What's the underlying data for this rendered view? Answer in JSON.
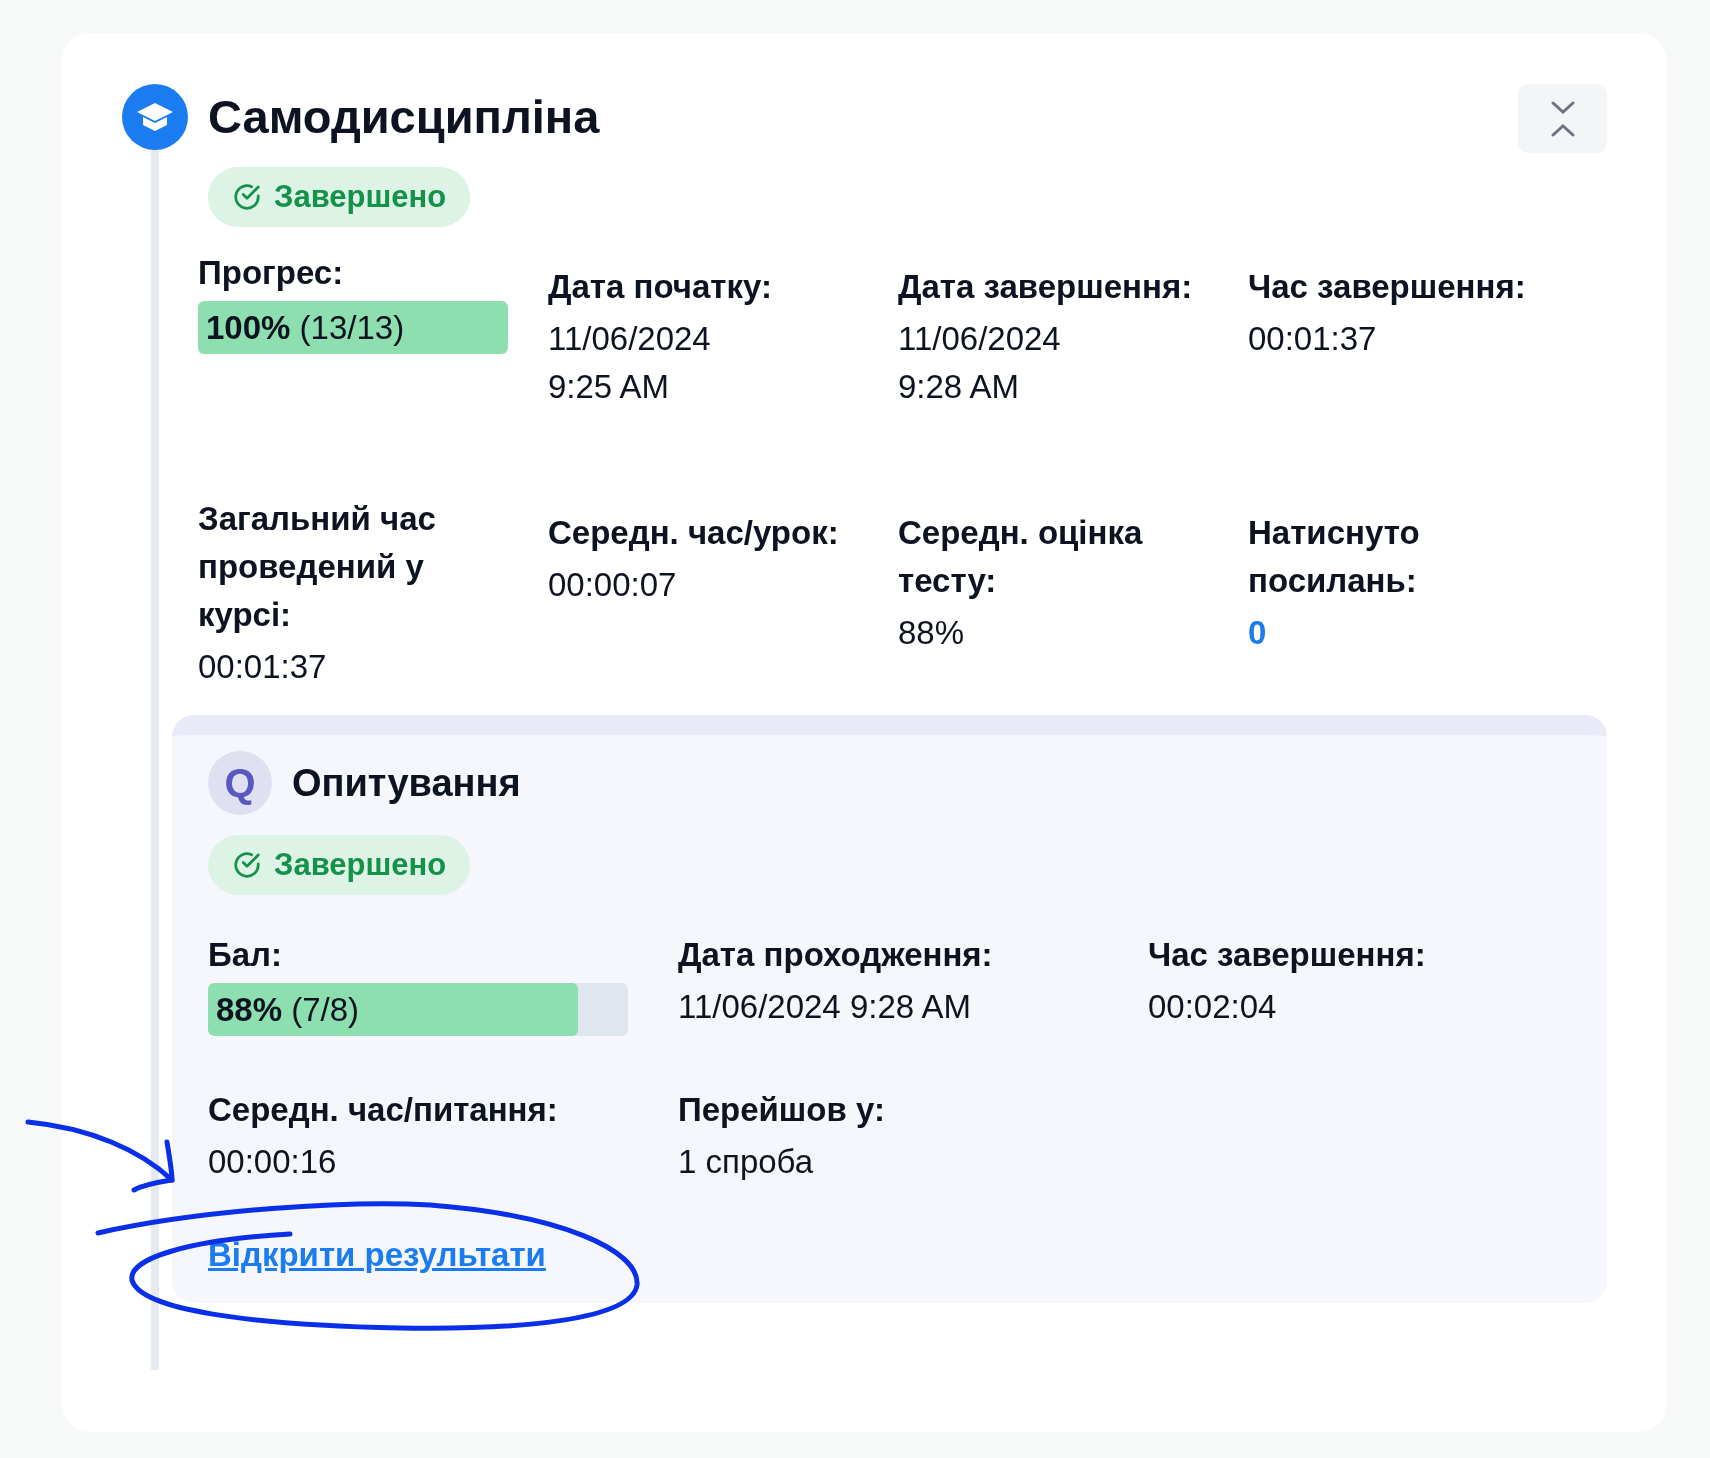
{
  "course": {
    "title": "Самодисципліна",
    "status": {
      "label": "Завершено",
      "completed": true
    },
    "stats": [
      {
        "kind": "progress",
        "label": "Прогрес:",
        "value": "**100%** (13/13)",
        "level": 1
      },
      {
        "kind": "text",
        "label": "Дата початку:",
        "value": "11/06/2024 9:25 AM"
      },
      {
        "kind": "text",
        "label": "Дата завершення:",
        "value": "11/06/2024 9:28 AM"
      },
      {
        "kind": "text",
        "label": "Час завершення:",
        "value": "00:01:37"
      },
      {
        "kind": "text",
        "label": "Загальний час проведений у курсі:",
        "value": "00:01:37"
      },
      {
        "kind": "text",
        "label": "Середн. час/урок:",
        "value": "00:00:07"
      },
      {
        "kind": "text",
        "label": "Середн. оцінка тесту:",
        "value": "88%"
      },
      {
        "kind": "count",
        "label": "Натиснуто посилань:",
        "value": "0"
      }
    ]
  },
  "quiz": {
    "avatar": "Q",
    "title": "Опитування",
    "status": {
      "label": "Завершено",
      "completed": true
    },
    "stats": [
      {
        "kind": "progress",
        "label": "Бал:",
        "value": "**88%** (7/8)",
        "level": 0.88
      },
      {
        "kind": "text",
        "label": "Дата проходження:",
        "value": "11/06/2024 9:28 AM"
      },
      {
        "kind": "text",
        "label": "Час завершення:",
        "value": "00:02:04"
      },
      {
        "kind": "text",
        "label": "Середн. час/питання:",
        "value": "00:00:16"
      },
      {
        "kind": "text",
        "label": "Перейшов у:",
        "value": "1 спроба"
      }
    ],
    "link": "Відкрити результати"
  }
}
